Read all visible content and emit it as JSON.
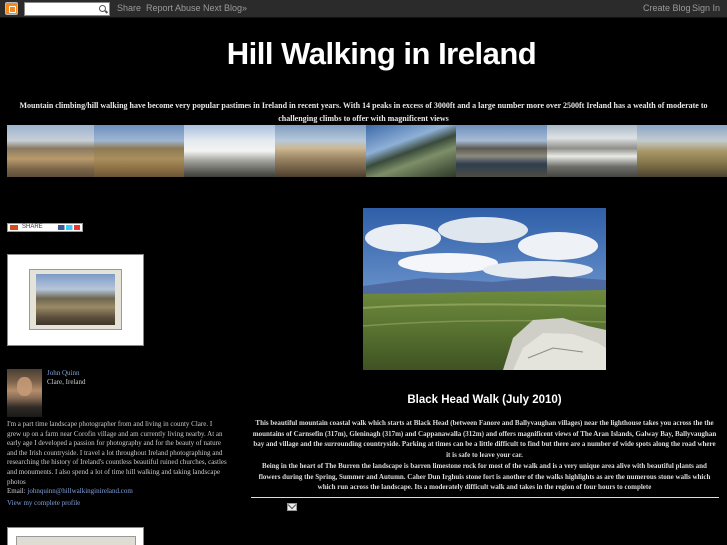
{
  "navbar": {
    "share": "Share",
    "report_abuse": "Report Abuse",
    "next_blog": "Next Blog»",
    "create_blog": "Create Blog",
    "sign_in": "Sign In"
  },
  "header": {
    "title": "Hill Walking in Ireland",
    "description": "Mountain climbing/hill walking have become very popular pastimes in Ireland in recent years. With 14 peaks in excess of 3000ft and a large number more over 2500ft Ireland has a wealth of moderate to challenging climbs to offer with magnificent views"
  },
  "sidebar": {
    "share_label": "SHARE",
    "profile": {
      "name": "John Quinn",
      "location": "Clare, Ireland",
      "bio": "I'm a part time landscape photographer from and living in county Clare. I grew up on a farm near Corofin village and am currently living nearby. At an early age I developed a passion for photography and for the beauty of nature and the Irish countryside. I travel a lot throughout Ireland photographing and researching the history of Ireland's countless beautiful ruined churches, castles and monuments. I also spend a lot of time hill walking and taking landscape photos",
      "email_label": "Email: ",
      "email": "johnquinn@hillwalkinginireland.com",
      "profile_link": "View my complete profile"
    }
  },
  "post": {
    "title": "Black Head Walk (July 2010)",
    "paragraph1": "This beautiful mountain coastal walk which starts at Black Head (between Fanore and Ballyvaughan villages) near the lighthouse takes you across the the mountains of Carnsefin (317m), Gleninagh (317m) and Cappanawalla (312m) and offers magnificent views of The Aran Islands, Galway Bay, Ballyvaughan bay and village and the surrounding countryside. Parking at times can be a little difficult to find but there are a number of wide spots along the road where it is safe to leave your car.",
    "paragraph2": "Being in the heart of The Burren the landscape is barren limestone rock for most of the walk and is a very unique area alive with beautiful plants and flowers during the Spring, Summer and Autumn. Caher Dun Irghuis stone fort is another of the walks highlights as are the numerous stone walls which which run across the landscape. Its a moderately difficult walk and takes in the region of four hours to complete"
  },
  "icons": [
    "blogger-logo-icon",
    "search-icon",
    "share-icon",
    "email-icon"
  ]
}
